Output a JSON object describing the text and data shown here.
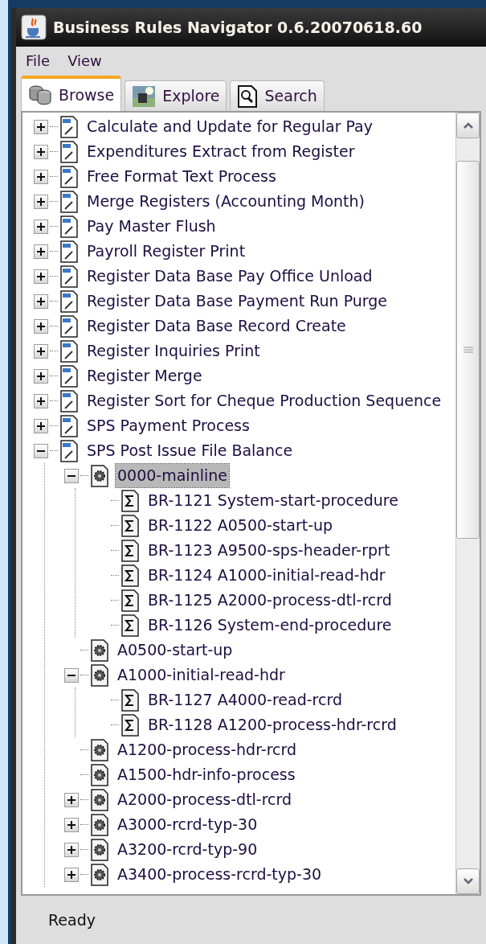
{
  "window": {
    "title": "Business Rules Navigator 0.6.20070618.60"
  },
  "menu": [
    "File",
    "View"
  ],
  "tabs": [
    {
      "label": "Browse",
      "kind": "database",
      "selected": true
    },
    {
      "label": "Explore",
      "kind": "picture",
      "selected": false
    },
    {
      "label": "Search",
      "kind": "search",
      "selected": false
    }
  ],
  "tree": [
    {
      "label": "Calculate and Update for Regular Pay",
      "kind": "document",
      "expanded": false,
      "selected": false
    },
    {
      "label": "Expenditures Extract from Register",
      "kind": "document",
      "expanded": false,
      "selected": false
    },
    {
      "label": "Free Format Text Process",
      "kind": "document",
      "expanded": false,
      "selected": false
    },
    {
      "label": "Merge Registers (Accounting Month)",
      "kind": "document",
      "expanded": false,
      "selected": false
    },
    {
      "label": "Pay Master Flush",
      "kind": "document",
      "expanded": false,
      "selected": false
    },
    {
      "label": "Payroll Register Print",
      "kind": "document",
      "expanded": false,
      "selected": false
    },
    {
      "label": "Register Data Base Pay Office Unload",
      "kind": "document",
      "expanded": false,
      "selected": false
    },
    {
      "label": "Register Data Base Payment Run Purge",
      "kind": "document",
      "expanded": false,
      "selected": false
    },
    {
      "label": "Register Data Base Record Create",
      "kind": "document",
      "expanded": false,
      "selected": false
    },
    {
      "label": "Register Inquiries Print",
      "kind": "document",
      "expanded": false,
      "selected": false
    },
    {
      "label": "Register Merge",
      "kind": "document",
      "expanded": false,
      "selected": false
    },
    {
      "label": "Register Sort for Cheque Production Sequence",
      "kind": "document",
      "expanded": false,
      "selected": false
    },
    {
      "label": "SPS Payment Process",
      "kind": "document",
      "expanded": false,
      "selected": false
    },
    {
      "label": "SPS Post Issue File Balance",
      "kind": "document",
      "expanded": true,
      "selected": false,
      "children": [
        {
          "label": "0000-mainline",
          "kind": "procedure",
          "expanded": true,
          "selected": true,
          "children": [
            {
              "label": "BR-1121 System-start-procedure",
              "kind": "rule",
              "selected": false
            },
            {
              "label": "BR-1122 A0500-start-up",
              "kind": "rule",
              "selected": false
            },
            {
              "label": "BR-1123 A9500-sps-header-rprt",
              "kind": "rule",
              "selected": false
            },
            {
              "label": "BR-1124 A1000-initial-read-hdr",
              "kind": "rule",
              "selected": false
            },
            {
              "label": "BR-1125 A2000-process-dtl-rcrd",
              "kind": "rule",
              "selected": false
            },
            {
              "label": "BR-1126 System-end-procedure",
              "kind": "rule",
              "selected": false
            }
          ]
        },
        {
          "label": "A0500-start-up",
          "kind": "procedure",
          "selected": false
        },
        {
          "label": "A1000-initial-read-hdr",
          "kind": "procedure",
          "expanded": true,
          "selected": false,
          "children": [
            {
              "label": "BR-1127 A4000-read-rcrd",
              "kind": "rule",
              "selected": false
            },
            {
              "label": "BR-1128 A1200-process-hdr-rcrd",
              "kind": "rule",
              "selected": false
            }
          ]
        },
        {
          "label": "A1200-process-hdr-rcrd",
          "kind": "procedure",
          "selected": false
        },
        {
          "label": "A1500-hdr-info-process",
          "kind": "procedure",
          "selected": false
        },
        {
          "label": "A2000-process-dtl-rcrd",
          "kind": "procedure",
          "expanded": false,
          "selected": false
        },
        {
          "label": "A3000-rcrd-typ-30",
          "kind": "procedure",
          "expanded": false,
          "selected": false
        },
        {
          "label": "A3200-rcrd-typ-90",
          "kind": "procedure",
          "expanded": false,
          "selected": false
        },
        {
          "label": "A3400-process-rcrd-typ-30",
          "kind": "procedure",
          "expanded": false,
          "selected": false
        }
      ]
    }
  ],
  "status_bar": "Ready"
}
